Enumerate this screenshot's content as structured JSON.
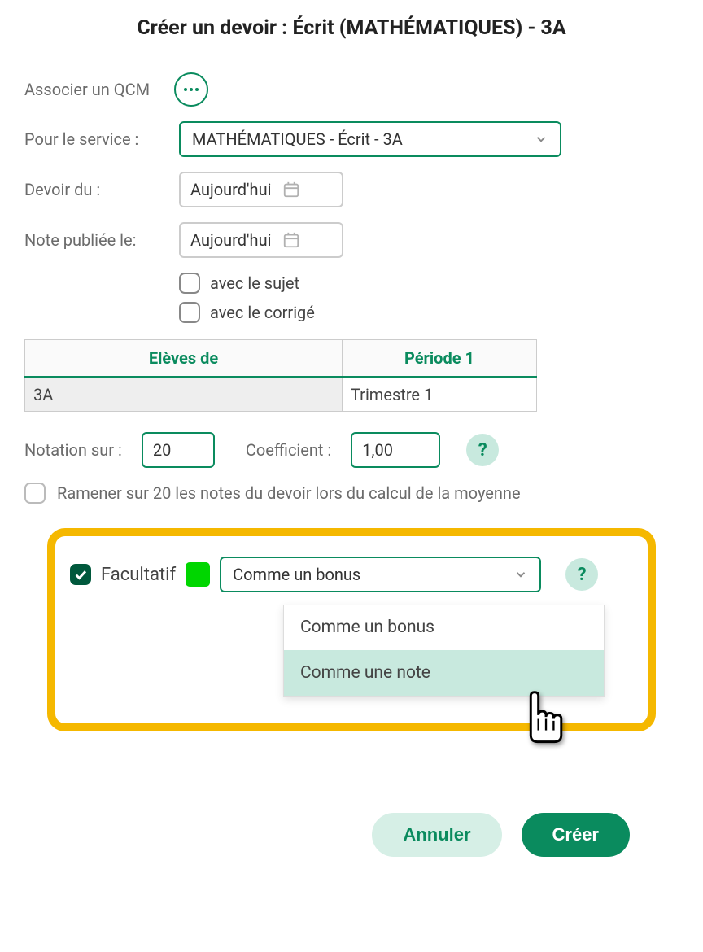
{
  "title": "Créer un devoir : Écrit (MATHÉMATIQUES) - 3A",
  "qcm": {
    "label": "Associer un QCM"
  },
  "service": {
    "label": "Pour le service :",
    "value": "MATHÉMATIQUES - Écrit - 3A"
  },
  "devoir_du": {
    "label": "Devoir du :",
    "value": "Aujourd'hui"
  },
  "note_pub": {
    "label": "Note publiée le:",
    "value": "Aujourd'hui"
  },
  "with_subject": "avec le sujet",
  "with_correction": "avec le corrigé",
  "table": {
    "head1": "Elèves de",
    "head2": "Période 1",
    "cell1": "3A",
    "cell2": "Trimestre 1"
  },
  "notation": {
    "label": "Notation sur :",
    "value": "20"
  },
  "coeff": {
    "label": "Coefficient :",
    "value": "1,00"
  },
  "help": "?",
  "normalize": "Ramener sur 20 les notes du devoir lors du calcul de la moyenne",
  "facultatif": {
    "label": "Facultatif",
    "selected": "Comme un bonus",
    "options": [
      "Comme un bonus",
      "Comme une note"
    ]
  },
  "buttons": {
    "cancel": "Annuler",
    "create": "Créer"
  }
}
